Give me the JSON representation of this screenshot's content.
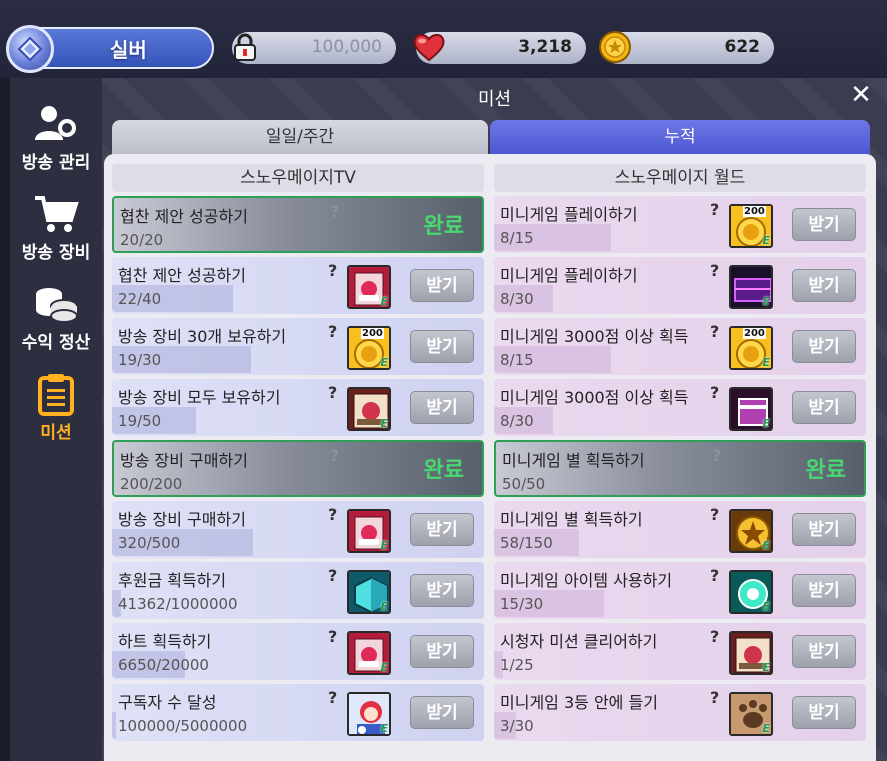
{
  "topbar": {
    "rank_label": "실버",
    "locked_value": "100,000",
    "hearts": "3,218",
    "coins": "622"
  },
  "sidebar": {
    "items": [
      {
        "label": "방송 관리",
        "icon": "users-gear-icon"
      },
      {
        "label": "방송 장비",
        "icon": "shopping-cart-icon"
      },
      {
        "label": "수익 정산",
        "icon": "coin-stack-icon"
      },
      {
        "label": "미션",
        "icon": "clipboard-icon",
        "active": true
      }
    ]
  },
  "window": {
    "title": "미션",
    "close": "✕"
  },
  "tabs": [
    {
      "label": "일일/주간",
      "active": false
    },
    {
      "label": "누적",
      "active": true
    }
  ],
  "columns": {
    "left": {
      "title": "스노우메이지TV",
      "rows": [
        {
          "name": "협찬 제안 성공하기",
          "progress": "20/20",
          "done": true,
          "status": "완료"
        },
        {
          "name": "협찬 제안 성공하기",
          "progress": "22/40",
          "claim": "받기",
          "reward": "card-pack-icon"
        },
        {
          "name": "방송 장비 30개 보유하기",
          "progress": "19/30",
          "claim": "받기",
          "reward": "gold-coin-200-icon",
          "reward_num": "200"
        },
        {
          "name": "방송 장비 모두 보유하기",
          "progress": "19/50",
          "claim": "받기",
          "reward": "photo-card-icon"
        },
        {
          "name": "방송 장비 구매하기",
          "progress": "200/200",
          "done": true,
          "status": "완료"
        },
        {
          "name": "방송 장비 구매하기",
          "progress": "320/500",
          "claim": "받기",
          "reward": "card-pack-icon"
        },
        {
          "name": "후원금 획득하기",
          "progress": "41362/1000000",
          "claim": "받기",
          "reward": "cyan-crystal-icon"
        },
        {
          "name": "하트 획득하기",
          "progress": "6650/20000",
          "claim": "받기",
          "reward": "card-pack-icon"
        },
        {
          "name": "구독자 수 달성",
          "progress": "100000/5000000",
          "claim": "받기",
          "reward": "character-icon"
        }
      ]
    },
    "right": {
      "title": "스노우메이지 월드",
      "rows": [
        {
          "name": "미니게임 플레이하기",
          "progress": "8/15",
          "claim": "받기",
          "reward": "gold-coin-200-icon",
          "reward_num": "200"
        },
        {
          "name": "미니게임 플레이하기",
          "progress": "8/30",
          "claim": "받기",
          "reward": "purple-stage-icon"
        },
        {
          "name": "미니게임 3000점 이상 획득",
          "progress": "8/15",
          "claim": "받기",
          "reward": "gold-coin-200-icon",
          "reward_num": "200"
        },
        {
          "name": "미니게임 3000점 이상 획득",
          "progress": "8/30",
          "claim": "받기",
          "reward": "purple-box-icon"
        },
        {
          "name": "미니게임 별 획득하기",
          "progress": "50/50",
          "done": true,
          "status": "완료"
        },
        {
          "name": "미니게임 별 획득하기",
          "progress": "58/150",
          "claim": "받기",
          "reward": "star-emblem-icon"
        },
        {
          "name": "미니게임 아이템 사용하기",
          "progress": "15/30",
          "claim": "받기",
          "reward": "teal-gem-icon"
        },
        {
          "name": "시청자 미션 클리어하기",
          "progress": "1/25",
          "claim": "받기",
          "reward": "photo-card-icon"
        },
        {
          "name": "미니게임 3등 안에 들기",
          "progress": "3/30",
          "claim": "받기",
          "reward": "paw-icon"
        }
      ]
    }
  },
  "colors": {
    "active_tab": "#4b55cf",
    "done_border": "#2ea056",
    "done_text": "#48d870",
    "active_sidebar": "#ffb21e"
  }
}
